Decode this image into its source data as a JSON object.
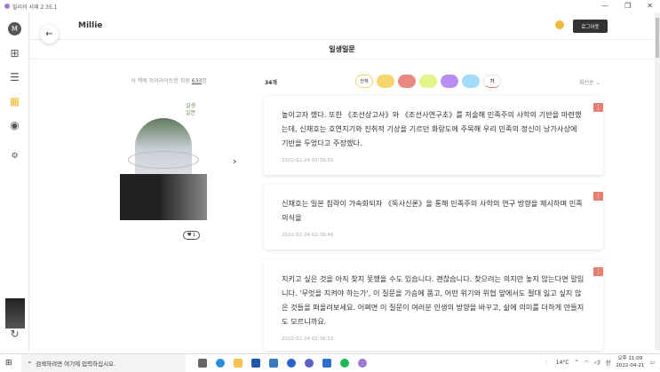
{
  "window": {
    "title": "밀리의 서재 2.35.1",
    "controls": [
      "—",
      "❐",
      "✕"
    ]
  },
  "header": {
    "logo": "Millie",
    "logout": "로그아웃"
  },
  "page": {
    "title": "일생일문"
  },
  "book": {
    "highlight_prefix": "이 책에 하이라이트한 회원 ",
    "highlight_count": "633",
    "highlight_suffix": "명",
    "cover_title": "일생 일문",
    "likes": "1"
  },
  "highlights": {
    "count": "34개",
    "filters": [
      {
        "label": "전체",
        "color": "#ffffff",
        "border": "#f2d46a"
      },
      {
        "label": "",
        "color": "#f5d66b"
      },
      {
        "label": "",
        "color": "#e88880"
      },
      {
        "label": "",
        "color": "#e1f58a"
      },
      {
        "label": "",
        "color": "#b58ef0"
      },
      {
        "label": "",
        "color": "#a2dbfb"
      },
      {
        "label": "가",
        "color": "#ffffff",
        "border": "#e5e5e5"
      }
    ],
    "sort": "최신순 ⌄",
    "items": [
      {
        "text": "높이고자 했다. 또한 《조선상고사》와 《조선사연구초》를 저술해 민족주의 사학의 기반을 마련했는데, 신채호는 호연지기와 진취적 기상을 기르던 화랑도에 주목해 우리 민족의 정신이 낭가사상에 기반을 두었다고 주장했다.",
        "time": "2022-02-24 02:39:55"
      },
      {
        "text": "신채호는 일본 침략이 가속화되자 《독사신론》을 통해 민족주의 사학의 연구 방향을 제시하며 민족 의식을",
        "time": "2022-02-24 02:39:48"
      },
      {
        "text": "지키고 싶은 것을 아직 찾지 못했을 수도 있습니다. 괜찮습니다. 찾으려는 의지만 놓지 않는다면 말입니다. '무엇을 지켜야 하는가', 이 질문을 가슴에 품고, 어떤 위기와 위협 앞에서도 절대 잃고 싶지 않은 것들을 떠올려보세요. 어쩌면 이 질문이 여러분 인생의 방향을 바꾸고, 삶에 의미를 더하게 만들지도 모르니까요.",
        "time": "2022-02-24 02:38:32"
      }
    ]
  },
  "taskbar": {
    "search_placeholder": "검색하려면 여기에 입력하십시오.",
    "weather": "14°C",
    "time": "오후 11:09",
    "date": "2022-04-21",
    "ime": "한"
  }
}
